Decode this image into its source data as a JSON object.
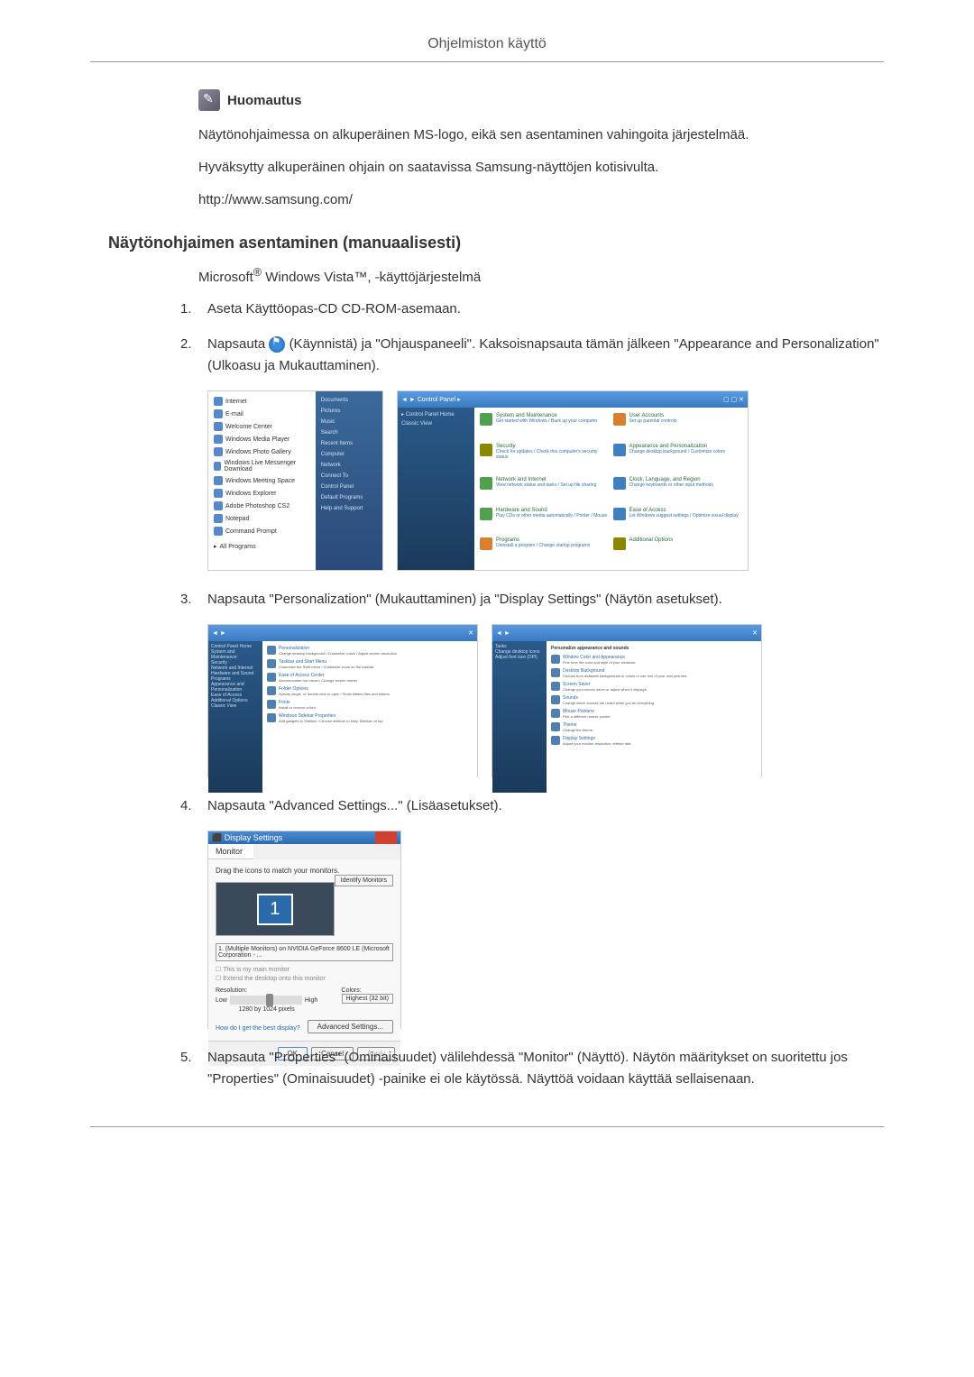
{
  "header": {
    "title": "Ohjelmiston käyttö"
  },
  "note": {
    "label": "Huomautus",
    "text1": "Näytönohjaimessa on alkuperäinen MS-logo, eikä sen asentaminen vahingoita järjestelmää.",
    "text2": "Hyväksytty alkuperäinen ohjain on saatavissa Samsung-näyttöjen kotisivulta.",
    "url": "http://www.samsung.com/"
  },
  "section": {
    "heading": "Näytönohjaimen asentaminen (manuaalisesti)",
    "subtext_prefix": "Microsoft",
    "subtext_suffix": " Windows Vista™, -käyttöjärjestelmä"
  },
  "steps": {
    "s1": {
      "num": "1.",
      "text": "Aseta Käyttöopas-CD CD-ROM-asemaan."
    },
    "s2": {
      "num": "2.",
      "prefix": "Napsauta ",
      "suffix": "(Käynnistä) ja \"Ohjauspaneeli\". Kaksoisnapsauta tämän jälkeen \"Appearance and Personalization\" (Ulkoasu ja Mukauttaminen)."
    },
    "s3": {
      "num": "3.",
      "text": "Napsauta \"Personalization\" (Mukauttaminen) ja \"Display Settings\" (Näytön asetukset)."
    },
    "s4": {
      "num": "4.",
      "text": "Napsauta \"Advanced Settings...\" (Lisäasetukset)."
    },
    "s5": {
      "num": "5.",
      "text": "Napsauta \"Properties\" (Ominaisuudet) välilehdessä \"Monitor\" (Näyttö). Näytön määritykset on suoritettu jos \"Properties\" (Ominaisuudet) -painike ei ole käytössä. Näyttöä voidaan käyttää sellaisenaan."
    }
  },
  "startMenu": {
    "items": [
      "Internet",
      "E-mail",
      "Welcome Center",
      "Windows Media Player",
      "Windows Photo Gallery",
      "Windows Live Messenger Download",
      "Windows Meeting Space",
      "Windows Explorer",
      "Adobe Photoshop CS2",
      "Notepad",
      "Command Prompt"
    ],
    "allPrograms": "All Programs",
    "right": [
      "Documents",
      "Pictures",
      "Music",
      "Search",
      "Recent Items",
      "Computer",
      "Network",
      "Connect To",
      "Control Panel",
      "Default Programs",
      "Help and Support"
    ]
  },
  "controlPanel": {
    "title": "Control Panel",
    "sidebar": [
      "Control Panel Home",
      "Classic View"
    ],
    "categories": [
      {
        "title": "System and Maintenance",
        "sub": "Get started with Windows / Back up your computer"
      },
      {
        "title": "Security",
        "sub": "Check for updates / Check this computer's security status"
      },
      {
        "title": "Network and Internet",
        "sub": "View network status and tasks / Set up file sharing"
      },
      {
        "title": "Hardware and Sound",
        "sub": "Play CDs or other media automatically / Printer / Mouse"
      },
      {
        "title": "Programs",
        "sub": "Uninstall a program / Change startup programs"
      },
      {
        "title": "User Accounts",
        "sub": "Set up parental controls"
      },
      {
        "title": "Appearance and Personalization",
        "sub": "Change desktop background / Customize colors"
      },
      {
        "title": "Clock, Language, and Region",
        "sub": "Change keyboards or other input methods"
      },
      {
        "title": "Ease of Access",
        "sub": "Let Windows suggest settings / Optimize visual display"
      },
      {
        "title": "Additional Options",
        "sub": ""
      }
    ]
  },
  "personalization1": {
    "sidebar": [
      "Control Panel Home",
      "System and Maintenance",
      "Security",
      "Network and Internet",
      "Hardware and Sound",
      "Programs",
      "Appearance and Personalization",
      "Ease of Access",
      "Additional Options",
      "Classic View"
    ],
    "items": [
      {
        "title": "Personalization",
        "desc": "Change desktop background / Customize colors / Adjust screen resolution"
      },
      {
        "title": "Taskbar and Start Menu",
        "desc": "Customize the Start menu / Customize icons on the taskbar"
      },
      {
        "title": "Ease of Access Center",
        "desc": "Accommodate low vision / Change screen reader"
      },
      {
        "title": "Folder Options",
        "desc": "Specify single- or double-click to open / Show hidden files and folders"
      },
      {
        "title": "Fonts",
        "desc": "Install or remove a font"
      },
      {
        "title": "Windows Sidebar Properties",
        "desc": "Add gadgets to Sidebar / Choose whether to keep Sidebar on top"
      }
    ]
  },
  "personalization2": {
    "heading": "Personalize appearance and sounds",
    "items": [
      {
        "title": "Window Color and Appearance",
        "desc": "Fine tune the color and style of your windows."
      },
      {
        "title": "Desktop Background",
        "desc": "Choose from available backgrounds or colors or use one of your own pictures."
      },
      {
        "title": "Screen Saver",
        "desc": "Change your screen saver or adjust when it displays."
      },
      {
        "title": "Sounds",
        "desc": "Change which sounds are heard when you do everything."
      },
      {
        "title": "Mouse Pointers",
        "desc": "Pick a different mouse pointer."
      },
      {
        "title": "Theme",
        "desc": "Change the theme."
      },
      {
        "title": "Display Settings",
        "desc": "Adjust your monitor resolution, refresh rate."
      }
    ]
  },
  "displaySettings": {
    "title": "Display Settings",
    "tab": "Monitor",
    "dragText": "Drag the icons to match your monitors.",
    "identifyBtn": "Identify Monitors",
    "monitorNum": "1",
    "dropdown": "1. (Multiple Monitors) on NVIDIA GeForce 8600 LE (Microsoft Corporation - ...",
    "check1": "This is my main monitor",
    "check2": "Extend the desktop onto this monitor",
    "resolutionLabel": "Resolution:",
    "low": "Low",
    "high": "High",
    "resValue": "1280 by 1024 pixels",
    "colorsLabel": "Colors:",
    "colorsValue": "Highest (32 bit)",
    "helpLink": "How do I get the best display?",
    "advancedBtn": "Advanced Settings...",
    "okBtn": "OK",
    "cancelBtn": "Cancel",
    "applyBtn": "Apply"
  }
}
